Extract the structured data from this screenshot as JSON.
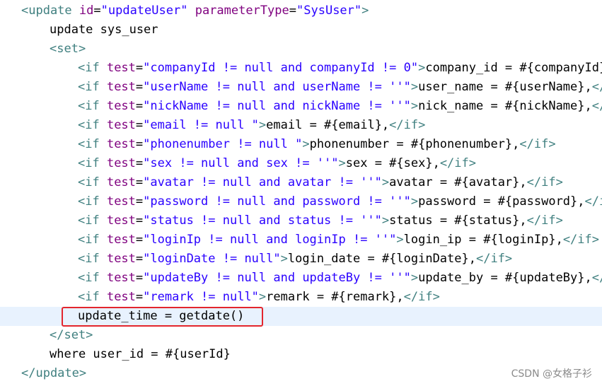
{
  "editor": {
    "indent_unit": "    ",
    "current_line_index": 16,
    "highlighted_line_index": 16,
    "lines": [
      {
        "indent": 0,
        "tokens": [
          [
            "tag",
            "<update "
          ],
          [
            "attr",
            "id"
          ],
          [
            "pun",
            "="
          ],
          [
            "val",
            "\"updateUser\""
          ],
          [
            "txt",
            " "
          ],
          [
            "attr",
            "parameterType"
          ],
          [
            "pun",
            "="
          ],
          [
            "val",
            "\"SysUser\""
          ],
          [
            "tag",
            ">"
          ]
        ]
      },
      {
        "indent": 1,
        "tokens": [
          [
            "txt",
            "update sys_user"
          ]
        ]
      },
      {
        "indent": 1,
        "tokens": [
          [
            "tag",
            "<set>"
          ]
        ]
      },
      {
        "indent": 2,
        "tokens": [
          [
            "tag",
            "<if "
          ],
          [
            "attr",
            "test"
          ],
          [
            "pun",
            "="
          ],
          [
            "val",
            "\"companyId != null and companyId != 0\""
          ],
          [
            "tag",
            ">"
          ],
          [
            "txt",
            "company_id = #{companyId},"
          ]
        ]
      },
      {
        "indent": 2,
        "tokens": [
          [
            "tag",
            "<if "
          ],
          [
            "attr",
            "test"
          ],
          [
            "pun",
            "="
          ],
          [
            "val",
            "\"userName != null and userName != ''\""
          ],
          [
            "tag",
            ">"
          ],
          [
            "txt",
            "user_name = #{userName},"
          ],
          [
            "tag",
            "</if>"
          ]
        ]
      },
      {
        "indent": 2,
        "tokens": [
          [
            "tag",
            "<if "
          ],
          [
            "attr",
            "test"
          ],
          [
            "pun",
            "="
          ],
          [
            "val",
            "\"nickName != null and nickName != ''\""
          ],
          [
            "tag",
            ">"
          ],
          [
            "txt",
            "nick_name = #{nickName},"
          ],
          [
            "tag",
            "</if>"
          ]
        ]
      },
      {
        "indent": 2,
        "tokens": [
          [
            "tag",
            "<if "
          ],
          [
            "attr",
            "test"
          ],
          [
            "pun",
            "="
          ],
          [
            "val",
            "\"email != null \""
          ],
          [
            "tag",
            ">"
          ],
          [
            "txt",
            "email = #{email},"
          ],
          [
            "tag",
            "</if>"
          ]
        ]
      },
      {
        "indent": 2,
        "tokens": [
          [
            "tag",
            "<if "
          ],
          [
            "attr",
            "test"
          ],
          [
            "pun",
            "="
          ],
          [
            "val",
            "\"phonenumber != null \""
          ],
          [
            "tag",
            ">"
          ],
          [
            "txt",
            "phonenumber = #{phonenumber},"
          ],
          [
            "tag",
            "</if>"
          ]
        ]
      },
      {
        "indent": 2,
        "tokens": [
          [
            "tag",
            "<if "
          ],
          [
            "attr",
            "test"
          ],
          [
            "pun",
            "="
          ],
          [
            "val",
            "\"sex != null and sex != ''\""
          ],
          [
            "tag",
            ">"
          ],
          [
            "txt",
            "sex = #{sex},"
          ],
          [
            "tag",
            "</if>"
          ]
        ]
      },
      {
        "indent": 2,
        "tokens": [
          [
            "tag",
            "<if "
          ],
          [
            "attr",
            "test"
          ],
          [
            "pun",
            "="
          ],
          [
            "val",
            "\"avatar != null and avatar != ''\""
          ],
          [
            "tag",
            ">"
          ],
          [
            "txt",
            "avatar = #{avatar},"
          ],
          [
            "tag",
            "</if>"
          ]
        ]
      },
      {
        "indent": 2,
        "tokens": [
          [
            "tag",
            "<if "
          ],
          [
            "attr",
            "test"
          ],
          [
            "pun",
            "="
          ],
          [
            "val",
            "\"password != null and password != ''\""
          ],
          [
            "tag",
            ">"
          ],
          [
            "txt",
            "password = #{password},"
          ],
          [
            "tag",
            "</if>"
          ]
        ]
      },
      {
        "indent": 2,
        "tokens": [
          [
            "tag",
            "<if "
          ],
          [
            "attr",
            "test"
          ],
          [
            "pun",
            "="
          ],
          [
            "val",
            "\"status != null and status != ''\""
          ],
          [
            "tag",
            ">"
          ],
          [
            "txt",
            "status = #{status},"
          ],
          [
            "tag",
            "</if>"
          ]
        ]
      },
      {
        "indent": 2,
        "tokens": [
          [
            "tag",
            "<if "
          ],
          [
            "attr",
            "test"
          ],
          [
            "pun",
            "="
          ],
          [
            "val",
            "\"loginIp != null and loginIp != ''\""
          ],
          [
            "tag",
            ">"
          ],
          [
            "txt",
            "login_ip = #{loginIp},"
          ],
          [
            "tag",
            "</if>"
          ]
        ]
      },
      {
        "indent": 2,
        "tokens": [
          [
            "tag",
            "<if "
          ],
          [
            "attr",
            "test"
          ],
          [
            "pun",
            "="
          ],
          [
            "val",
            "\"loginDate != null\""
          ],
          [
            "tag",
            ">"
          ],
          [
            "txt",
            "login_date = #{loginDate},"
          ],
          [
            "tag",
            "</if>"
          ]
        ]
      },
      {
        "indent": 2,
        "tokens": [
          [
            "tag",
            "<if "
          ],
          [
            "attr",
            "test"
          ],
          [
            "pun",
            "="
          ],
          [
            "val",
            "\"updateBy != null and updateBy != ''\""
          ],
          [
            "tag",
            ">"
          ],
          [
            "txt",
            "update_by = #{updateBy},"
          ],
          [
            "tag",
            "</if>"
          ]
        ]
      },
      {
        "indent": 2,
        "tokens": [
          [
            "tag",
            "<if "
          ],
          [
            "attr",
            "test"
          ],
          [
            "pun",
            "="
          ],
          [
            "val",
            "\"remark != null\""
          ],
          [
            "tag",
            ">"
          ],
          [
            "txt",
            "remark = #{remark},"
          ],
          [
            "tag",
            "</if>"
          ]
        ]
      },
      {
        "indent": 2,
        "tokens": [
          [
            "txt",
            "update_time = getdate()"
          ]
        ]
      },
      {
        "indent": 1,
        "tokens": [
          [
            "tag",
            "</set>"
          ]
        ]
      },
      {
        "indent": 1,
        "tokens": [
          [
            "txt",
            "where user_id = #{userId}"
          ]
        ]
      },
      {
        "indent": 0,
        "tokens": [
          [
            "tag",
            "</update>"
          ]
        ]
      }
    ]
  },
  "colors": {
    "tag": "#3f7f7f",
    "attribute": "#7f007f",
    "string": "#2a00ff",
    "text": "#000000",
    "current_line_bg": "#e8f2fe",
    "annotation_box": "#e3262d"
  },
  "watermark": {
    "text": "CSDN @女格子衫"
  }
}
